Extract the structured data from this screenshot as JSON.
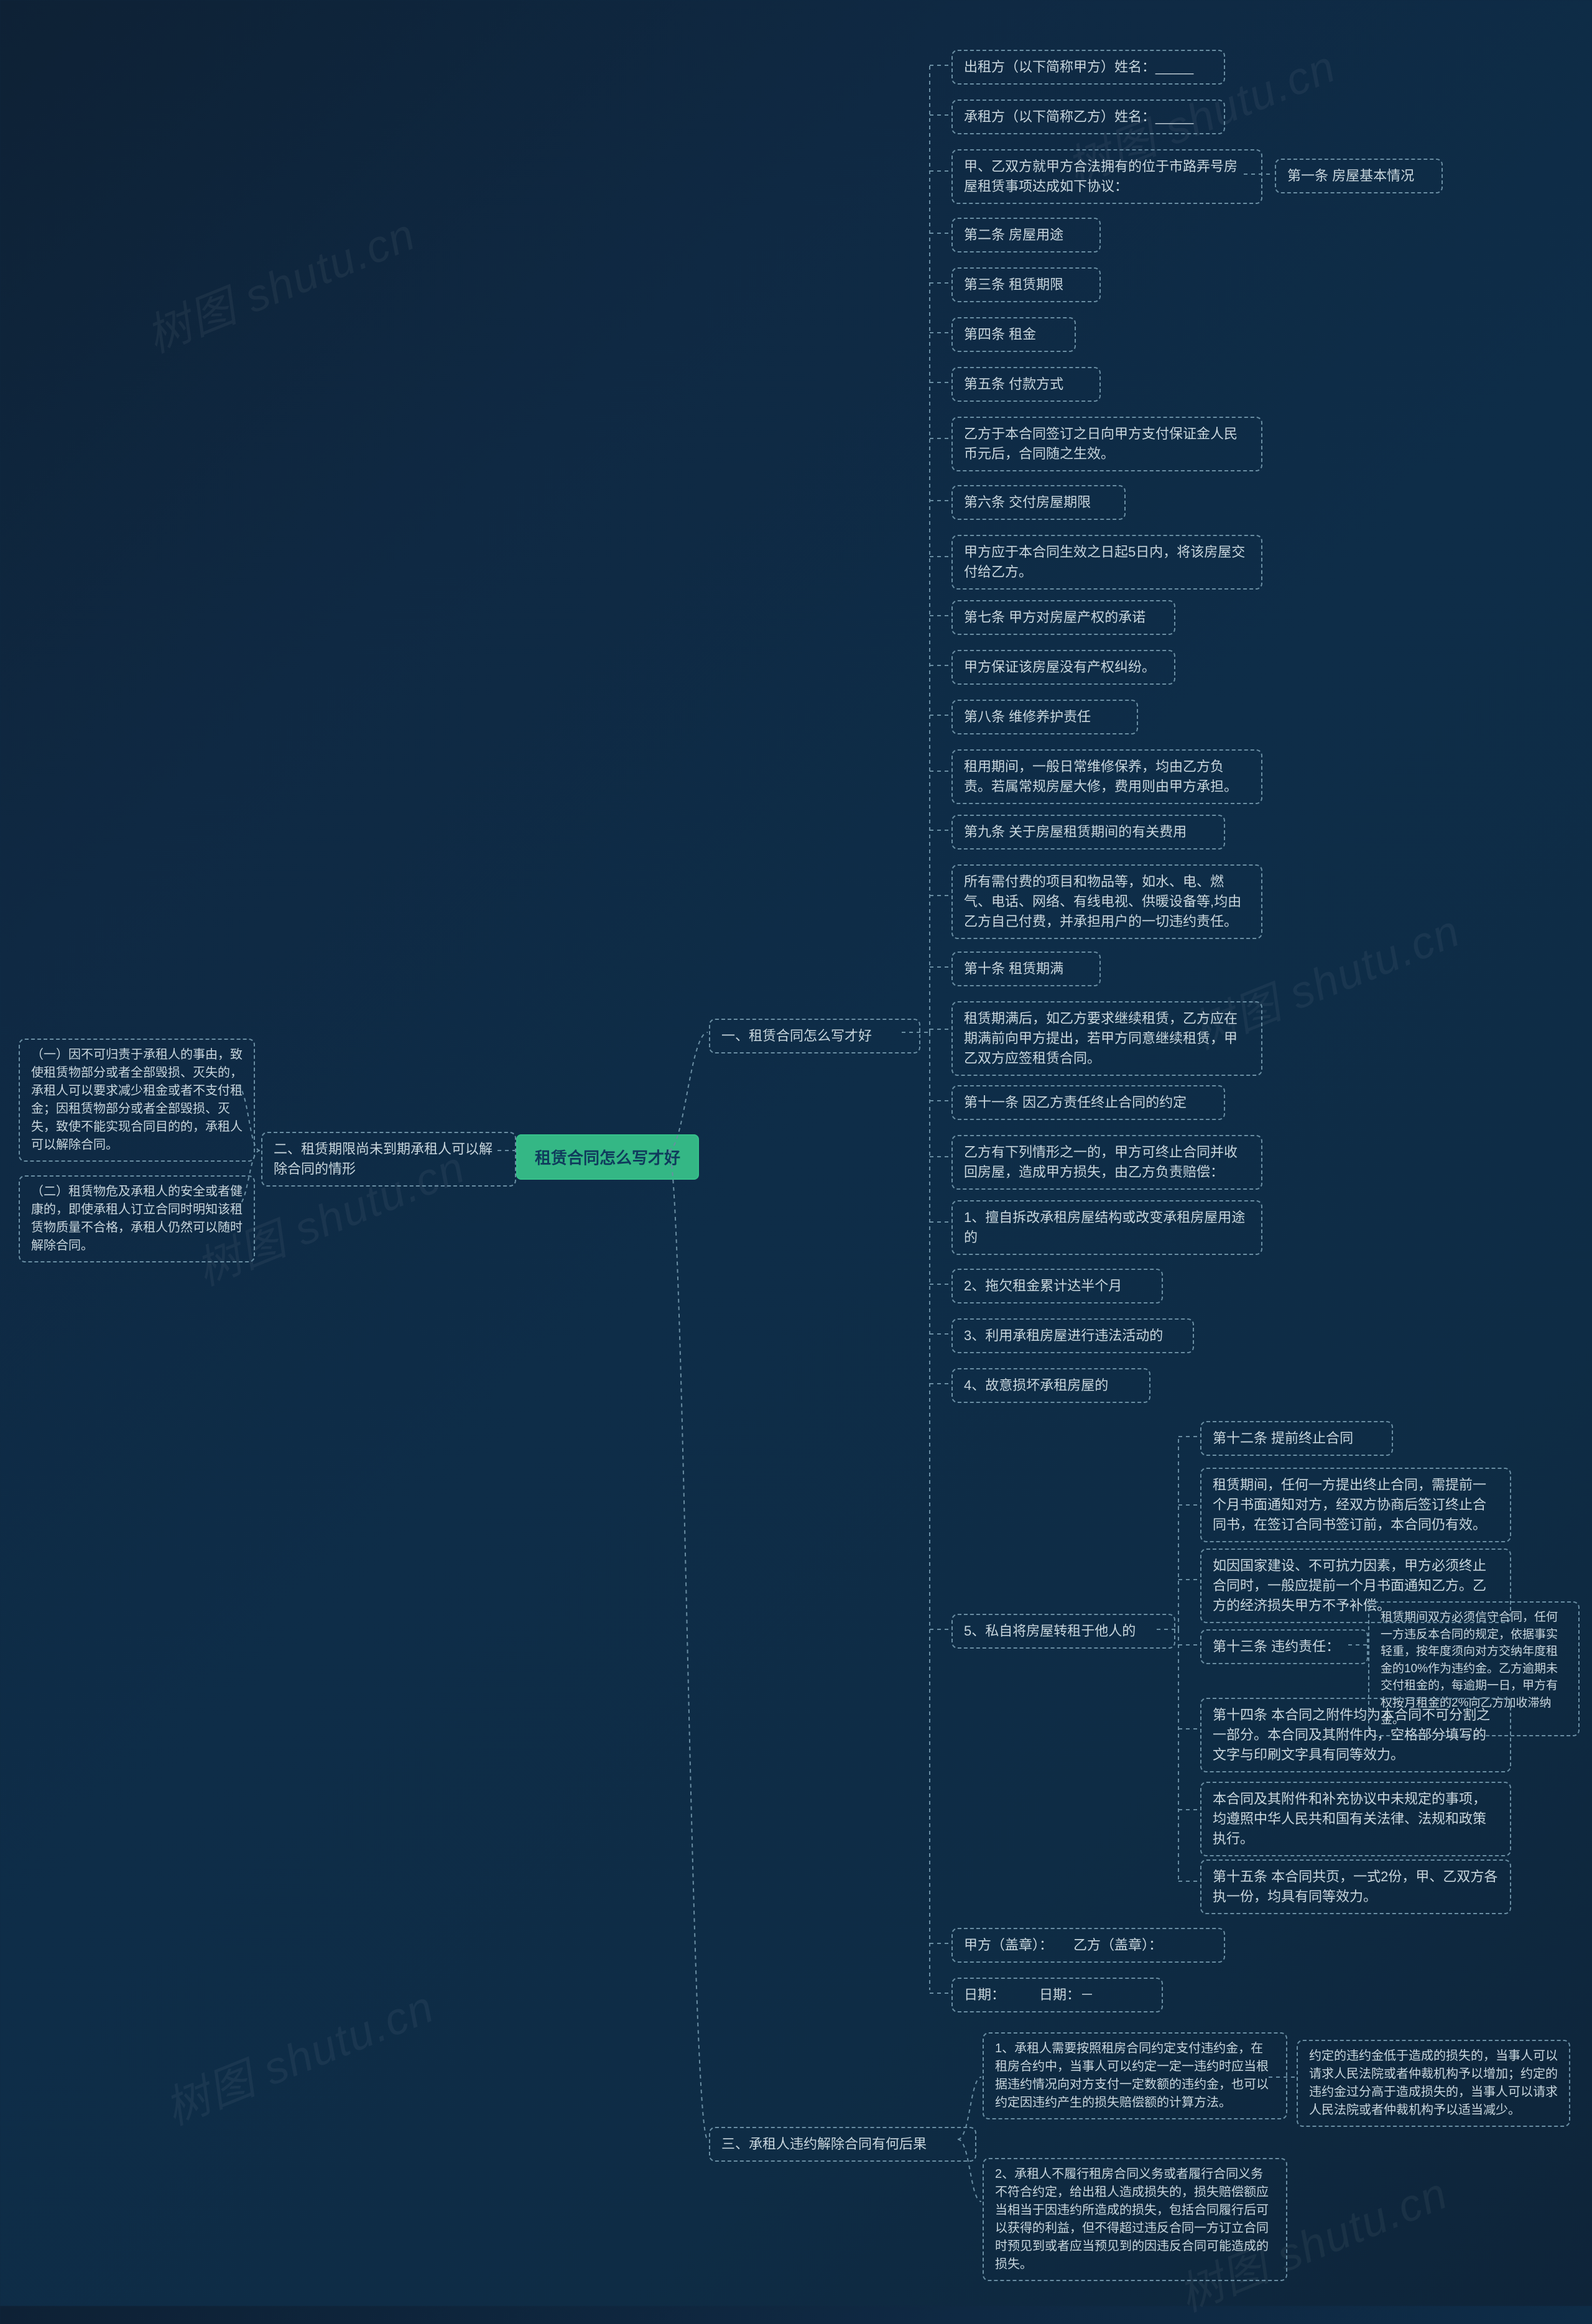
{
  "watermark": "树图 shutu.cn",
  "root": {
    "title": "租赁合同怎么写才好"
  },
  "sec1": {
    "title": "一、租赁合同怎么写才好",
    "n01": "出租方（以下简称甲方）姓名：_____",
    "n02": "承租方（以下简称乙方）姓名：_____",
    "n03": "甲、乙双方就甲方合法拥有的位于市路弄号房屋租赁事项达成如下协议：",
    "n03r": "第一条 房屋基本情况",
    "n04": "第二条 房屋用途",
    "n05": "第三条 租赁期限",
    "n06": "第四条 租金",
    "n07": "第五条 付款方式",
    "n08": "乙方于本合同签订之日向甲方支付保证金人民币元后，合同随之生效。",
    "n09": "第六条 交付房屋期限",
    "n10": "甲方应于本合同生效之日起5日内，将该房屋交付给乙方。",
    "n11": "第七条 甲方对房屋产权的承诺",
    "n12": "甲方保证该房屋没有产权纠纷。",
    "n13": "第八条 维修养护责任",
    "n14": "租用期间，一般日常维修保养，均由乙方负责。若属常规房屋大修，费用则由甲方承担。",
    "n15": "第九条 关于房屋租赁期间的有关费用",
    "n16": "所有需付费的项目和物品等，如水、电、燃气、电话、网络、有线电视、供暖设备等,均由乙方自己付费，并承担用户的一切违约责任。",
    "n17": "第十条 租赁期满",
    "n18": "租赁期满后，如乙方要求继续租赁，乙方应在期满前向甲方提出，若甲方同意继续租赁，甲乙双方应签租赁合同。",
    "n19": "第十一条 因乙方责任终止合同的约定",
    "n20": "乙方有下列情形之一的，甲方可终止合同并收回房屋，造成甲方损失，由乙方负责赔偿：",
    "n21": "1、擅自拆改承租房屋结构或改变承租房屋用途的",
    "n22": "2、拖欠租金累计达半个月",
    "n23": "3、利用承租房屋进行违法活动的",
    "n24": "4、故意损坏承租房屋的",
    "n25": "5、私自将房屋转租于他人的",
    "n25_a": "第十二条 提前终止合同",
    "n25_b": "租赁期间，任何一方提出终止合同，需提前一个月书面通知对方，经双方协商后签订终止合同书，在签订合同书签订前，本合同仍有效。",
    "n25_c": "如因国家建设、不可抗力因素，甲方必须终止合同时，一般应提前一个月书面通知乙方。乙方的经济损失甲方不予补偿。",
    "n25_d": "第十三条 违约责任：",
    "n25_d1": "租赁期间双方必须信守合同，任何一方违反本合同的规定，依据事实轻重，按年度须向对方交纳年度租金的10%作为违约金。乙方逾期未交付租金的，每逾期一日，甲方有权按月租金的2%向乙方加收滞纳金。",
    "n25_e": "第十四条 本合同之附件均为本合同不可分割之一部分。本合同及其附件内，空格部分填写的文字与印刷文字具有同等效力。",
    "n25_f": "本合同及其附件和补充协议中未规定的事项，均遵照中华人民共和国有关法律、法规和政策执行。",
    "n25_g": "第十五条 本合同共页，一式2份，甲、乙双方各执一份，均具有同等效力。",
    "n26": "甲方（盖章）：　　乙方（盖章）：",
    "n27": "日期：　　　日期：－"
  },
  "sec2": {
    "title": "二、租赁期限尚未到期承租人可以解除合同的情形",
    "n1": "（一）因不可归责于承租人的事由，致使租赁物部分或者全部毁损、灭失的，承租人可以要求减少租金或者不支付租金；因租赁物部分或者全部毁损、灭失，致使不能实现合同目的的，承租人可以解除合同。",
    "n2": "（二）租赁物危及承租人的安全或者健康的，即使承租人订立合同时明知该租赁物质量不合格，承租人仍然可以随时解除合同。"
  },
  "sec3": {
    "title": "三、承租人违约解除合同有何后果",
    "n1": "1、承租人需要按照租房合同约定支付违约金，在租房合约中，当事人可以约定一定一违约时应当根据违约情况向对方支付一定数额的违约金，也可以约定因违约产生的损失赔偿额的计算方法。",
    "n1r": "约定的违约金低于造成的损失的，当事人可以请求人民法院或者仲裁机构予以增加；约定的违约金过分高于造成损失的，当事人可以请求人民法院或者仲裁机构予以适当减少。",
    "n2": "2、承租人不履行租房合同义务或者履行合同义务不符合约定，给出租人造成损失的，损失赔偿额应当相当于因违约所造成的损失，包括合同履行后可以获得的利益，但不得超过违反合同一方订立合同时预见到或者应当预见到的因违反合同可能造成的损失。"
  },
  "chart_data": {
    "type": "mindmap",
    "root": "租赁合同怎么写才好",
    "children": [
      {
        "label": "一、租赁合同怎么写才好",
        "children": [
          "出租方（以下简称甲方）姓名：_____",
          "承租方（以下简称乙方）姓名：_____",
          {
            "label": "甲、乙双方就甲方合法拥有的位于市路弄号房屋租赁事项达成如下协议：",
            "children": [
              "第一条 房屋基本情况"
            ]
          },
          "第二条 房屋用途",
          "第三条 租赁期限",
          "第四条 租金",
          "第五条 付款方式",
          "乙方于本合同签订之日向甲方支付保证金人民币元后，合同随之生效。",
          "第六条 交付房屋期限",
          "甲方应于本合同生效之日起5日内，将该房屋交付给乙方。",
          "第七条 甲方对房屋产权的承诺",
          "甲方保证该房屋没有产权纠纷。",
          "第八条 维修养护责任",
          "租用期间，一般日常维修保养，均由乙方负责。若属常规房屋大修，费用则由甲方承担。",
          "第九条 关于房屋租赁期间的有关费用",
          "所有需付费的项目和物品等，如水、电、燃气、电话、网络、有线电视、供暖设备等,均由乙方自己付费，并承担用户的一切违约责任。",
          "第十条 租赁期满",
          "租赁期满后，如乙方要求继续租赁，乙方应在期满前向甲方提出，若甲方同意继续租赁，甲乙双方应签租赁合同。",
          "第十一条 因乙方责任终止合同的约定",
          "乙方有下列情形之一的，甲方可终止合同并收回房屋，造成甲方损失，由乙方负责赔偿：",
          "1、擅自拆改承租房屋结构或改变承租房屋用途的",
          "2、拖欠租金累计达半个月",
          "3、利用承租房屋进行违法活动的",
          "4、故意损坏承租房屋的",
          {
            "label": "5、私自将房屋转租于他人的",
            "children": [
              "第十二条 提前终止合同",
              "租赁期间，任何一方提出终止合同，需提前一个月书面通知对方，经双方协商后签订终止合同书，在签订合同书签订前，本合同仍有效。",
              "如因国家建设、不可抗力因素，甲方必须终止合同时，一般应提前一个月书面通知乙方。乙方的经济损失甲方不予补偿。",
              {
                "label": "第十三条 违约责任：",
                "children": [
                  "租赁期间双方必须信守合同，任何一方违反本合同的规定，依据事实轻重，按年度须向对方交纳年度租金的10%作为违约金。乙方逾期未交付租金的，每逾期一日，甲方有权按月租金的2%向乙方加收滞纳金。"
                ]
              },
              "第十四条 本合同之附件均为本合同不可分割之一部分。本合同及其附件内，空格部分填写的文字与印刷文字具有同等效力。",
              "本合同及其附件和补充协议中未规定的事项，均遵照中华人民共和国有关法律、法规和政策执行。",
              "第十五条 本合同共页，一式2份，甲、乙双方各执一份，均具有同等效力。"
            ]
          },
          "甲方（盖章）：　　乙方（盖章）：",
          "日期：　　　日期：－"
        ]
      },
      {
        "label": "二、租赁期限尚未到期承租人可以解除合同的情形",
        "children": [
          "（一）因不可归责于承租人的事由，致使租赁物部分或者全部毁损、灭失的，承租人可以要求减少租金或者不支付租金；因租赁物部分或者全部毁损、灭失，致使不能实现合同目的的，承租人可以解除合同。",
          "（二）租赁物危及承租人的安全或者健康的，即使承租人订立合同时明知该租赁物质量不合格，承租人仍然可以随时解除合同。"
        ]
      },
      {
        "label": "三、承租人违约解除合同有何后果",
        "children": [
          {
            "label": "1、承租人需要按照租房合同约定支付违约金，在租房合约中，当事人可以约定一定一违约时应当根据违约情况向对方支付一定数额的违约金，也可以约定因违约产生的损失赔偿额的计算方法。",
            "children": [
              "约定的违约金低于造成的损失的，当事人可以请求人民法院或者仲裁机构予以增加；约定的违约金过分高于造成损失的，当事人可以请求人民法院或者仲裁机构予以适当减少。"
            ]
          },
          "2、承租人不履行租房合同义务或者履行合同义务不符合约定，给出租人造成损失的，损失赔偿额应当相当于因违约所造成的损失，包括合同履行后可以获得的利益，但不得超过违反合同一方订立合同时预见到或者应当预见到的因违反合同可能造成的损失。"
        ]
      }
    ]
  }
}
